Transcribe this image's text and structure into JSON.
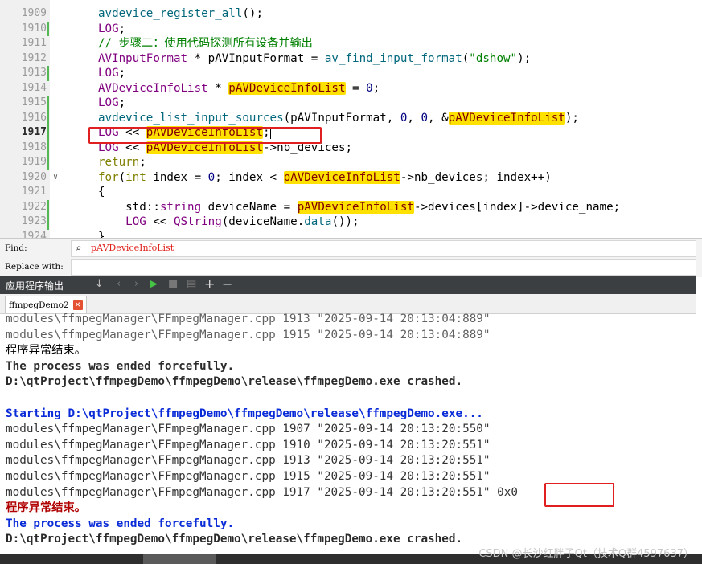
{
  "editor": {
    "lines": [
      {
        "num": "1909",
        "parts": [
          [
            "fn",
            "avdevice_register_all"
          ],
          [
            "p",
            "();"
          ]
        ]
      },
      {
        "num": "1910",
        "parts": [
          [
            "mac",
            "LOG"
          ],
          [
            "p",
            ";"
          ]
        ]
      },
      {
        "num": "1911",
        "parts": [
          [
            "cm",
            "// 步骤二：使用代码探测所有设备并输出"
          ]
        ]
      },
      {
        "num": "1912",
        "parts": [
          [
            "ty",
            "AVInputFormat"
          ],
          [
            "p",
            " * pAVInputFormat = "
          ],
          [
            "fn",
            "av_find_input_format"
          ],
          [
            "p",
            "("
          ],
          [
            "str",
            "\"dshow\""
          ],
          [
            "p",
            ");"
          ]
        ]
      },
      {
        "num": "1913",
        "parts": [
          [
            "mac",
            "LOG"
          ],
          [
            "p",
            ";"
          ]
        ]
      },
      {
        "num": "1914",
        "parts": [
          [
            "ty",
            "AVDeviceInfoList"
          ],
          [
            "p",
            " * "
          ],
          [
            "hl",
            "pAVDeviceInfoList"
          ],
          [
            "p",
            " = "
          ],
          [
            "num",
            "0"
          ],
          [
            "p",
            ";"
          ]
        ]
      },
      {
        "num": "1915",
        "parts": [
          [
            "mac",
            "LOG"
          ],
          [
            "p",
            ";"
          ]
        ]
      },
      {
        "num": "1916",
        "parts": [
          [
            "fn",
            "avdevice_list_input_sources"
          ],
          [
            "p",
            "(pAVInputFormat, "
          ],
          [
            "num",
            "0"
          ],
          [
            "p",
            ", "
          ],
          [
            "num",
            "0"
          ],
          [
            "p",
            ", &"
          ],
          [
            "hl",
            "pAVDeviceInfoList"
          ],
          [
            "p",
            ");"
          ]
        ]
      },
      {
        "num": "1917",
        "parts": [
          [
            "mac",
            "LOG"
          ],
          [
            "p",
            " << "
          ],
          [
            "hl",
            "pAVDeviceInfoList"
          ],
          [
            "p",
            ";"
          ]
        ]
      },
      {
        "num": "1918",
        "parts": [
          [
            "mac",
            "LOG"
          ],
          [
            "p",
            " << "
          ],
          [
            "hl",
            "pAVDeviceInfoList"
          ],
          [
            "p",
            "->nb_devices;"
          ]
        ]
      },
      {
        "num": "1919",
        "parts": [
          [
            "kw",
            "return"
          ],
          [
            "p",
            ";"
          ]
        ]
      },
      {
        "num": "1920",
        "parts": [
          [
            "kw",
            "for"
          ],
          [
            "p",
            "("
          ],
          [
            "kw",
            "int"
          ],
          [
            "p",
            " index = "
          ],
          [
            "num",
            "0"
          ],
          [
            "p",
            "; index < "
          ],
          [
            "hl",
            "pAVDeviceInfoList"
          ],
          [
            "p",
            "->nb_devices; index++)"
          ]
        ]
      },
      {
        "num": "1921",
        "parts": [
          [
            "p",
            "{"
          ]
        ]
      },
      {
        "num": "1922",
        "parts": [
          [
            "p",
            "    std::"
          ],
          [
            "ty",
            "string"
          ],
          [
            "p",
            " deviceName = "
          ],
          [
            "hl",
            "pAVDeviceInfoList"
          ],
          [
            "p",
            "->devices[index]->device_name;"
          ]
        ]
      },
      {
        "num": "1923",
        "parts": [
          [
            "p",
            "    "
          ],
          [
            "mac",
            "LOG"
          ],
          [
            "p",
            " << "
          ],
          [
            "ty",
            "QString"
          ],
          [
            "p",
            "(deviceName."
          ],
          [
            "fn",
            "data"
          ],
          [
            "p",
            "());"
          ]
        ]
      },
      {
        "num": "1924",
        "parts": [
          [
            "p",
            "}"
          ]
        ]
      }
    ],
    "current_line": "1917"
  },
  "find_bar": {
    "find_label": "Find:",
    "find_value": "pAVDeviceInfoList",
    "replace_label": "Replace with:",
    "replace_value": ""
  },
  "output_panel": {
    "title": "应用程序输出",
    "tab_label": "ffmpegDemo2",
    "tab_close": "×"
  },
  "output_lines": [
    {
      "style": "o-gray",
      "text": "modules\\ffmpegManager\\FFmpegManager.cpp 1913 \"2025-09-14 20:13:04:889\""
    },
    {
      "style": "o-gray",
      "text": "modules\\ffmpegManager\\FFmpegManager.cpp 1915 \"2025-09-14 20:13:04:889\""
    },
    {
      "style": "o-black zh",
      "text": "程序异常结束。"
    },
    {
      "style": "o-bold",
      "text": "The process was ended forcefully."
    },
    {
      "style": "o-bold",
      "text": "D:\\qtProject\\ffmpegDemo\\ffmpegDemo\\release\\ffmpegDemo.exe crashed."
    },
    {
      "style": "o-gray",
      "text": ""
    },
    {
      "style": "o-blue",
      "text": "Starting D:\\qtProject\\ffmpegDemo\\ffmpegDemo\\release\\ffmpegDemo.exe..."
    },
    {
      "style": "o-dark",
      "text": "modules\\ffmpegManager\\FFmpegManager.cpp 1907 \"2025-09-14 20:13:20:550\""
    },
    {
      "style": "o-dark",
      "text": "modules\\ffmpegManager\\FFmpegManager.cpp 1910 \"2025-09-14 20:13:20:551\""
    },
    {
      "style": "o-dark",
      "text": "modules\\ffmpegManager\\FFmpegManager.cpp 1913 \"2025-09-14 20:13:20:551\""
    },
    {
      "style": "o-dark",
      "text": "modules\\ffmpegManager\\FFmpegManager.cpp 1915 \"2025-09-14 20:13:20:551\""
    },
    {
      "style": "o-dark",
      "text": "modules\\ffmpegManager\\FFmpegManager.cpp 1917 \"2025-09-14 20:13:20:551\" 0x0"
    },
    {
      "style": "o-red zh",
      "text": "程序异常结束。"
    },
    {
      "style": "o-blue",
      "text": "The process was ended forcefully."
    },
    {
      "style": "o-bold",
      "text": "D:\\qtProject\\ffmpegDemo\\ffmpegDemo\\release\\ffmpegDemo.exe crashed."
    }
  ],
  "watermark": "CSDN @长沙红胖子Qt（技术Q群4597637）",
  "icons": {
    "search": "search-icon",
    "run": "run-icon",
    "add": "plus-icon",
    "remove": "minus-icon"
  }
}
